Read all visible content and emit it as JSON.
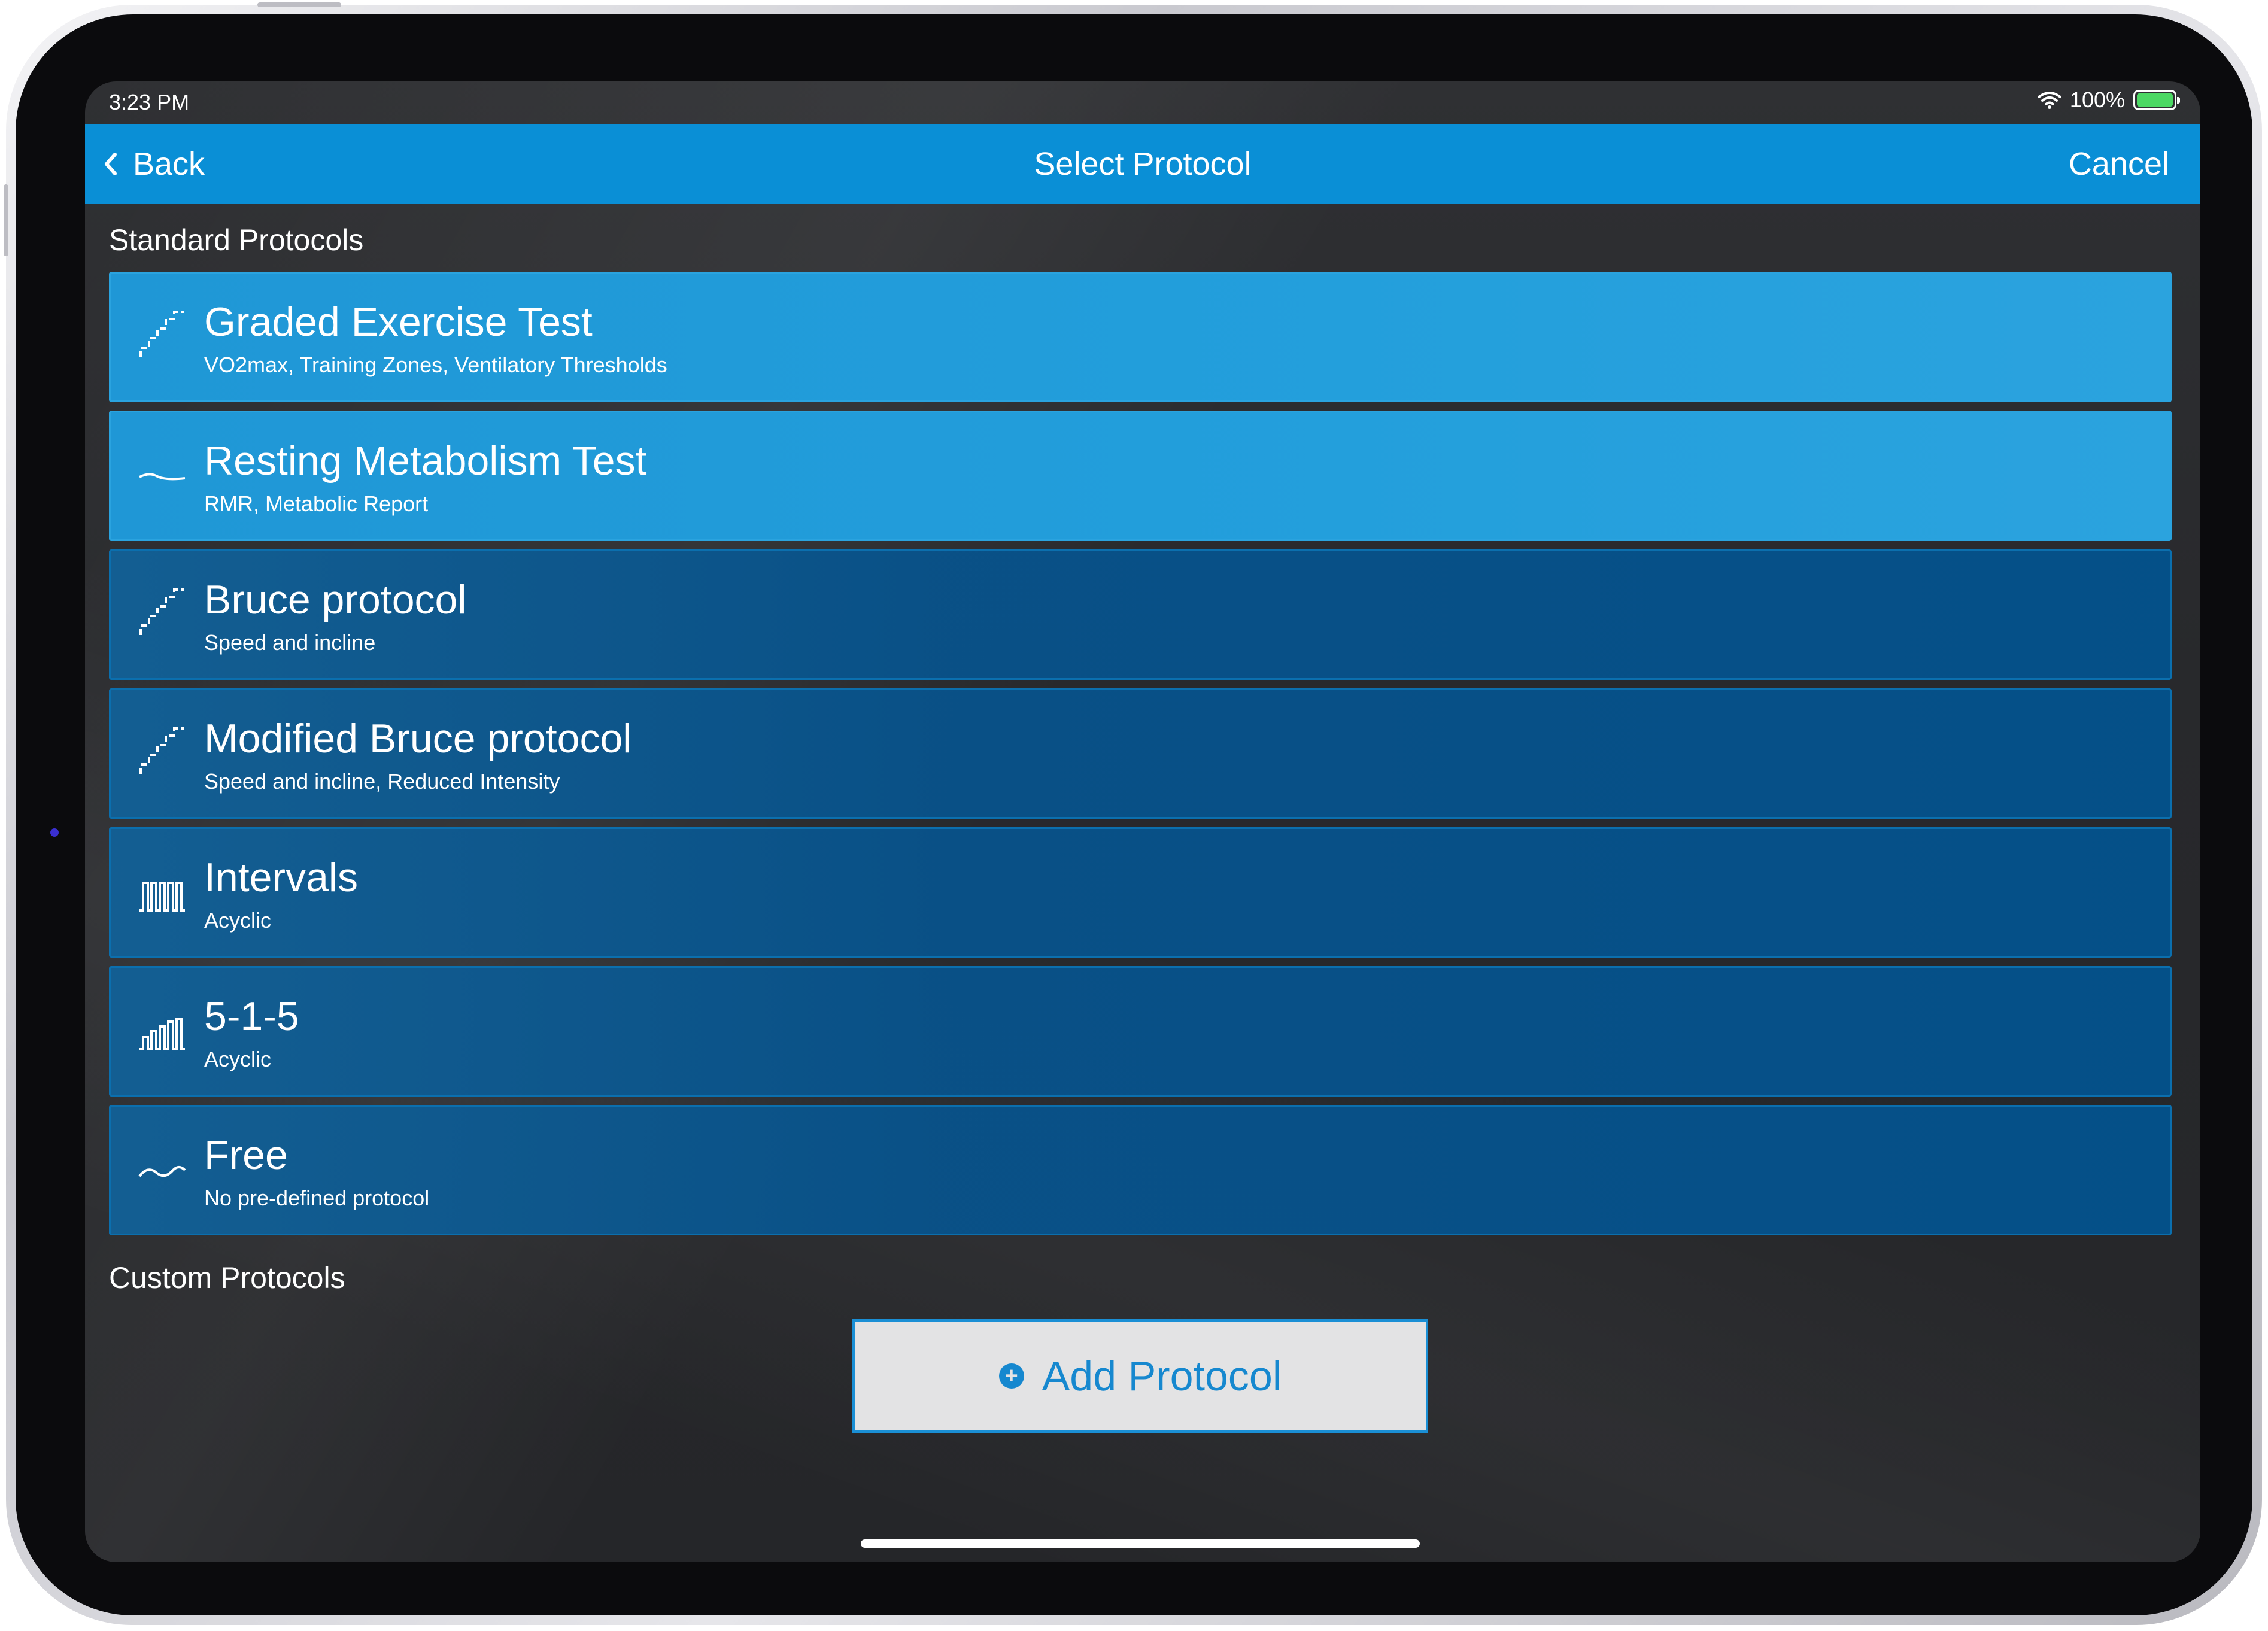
{
  "status_bar": {
    "time": "3:23 PM",
    "battery": "100%",
    "battery_level": 1.0
  },
  "nav": {
    "back_label": "Back",
    "title": "Select Protocol",
    "cancel_label": "Cancel"
  },
  "standard_section": {
    "title": "Standard Protocols"
  },
  "protocols": [
    {
      "title": "Graded Exercise Test",
      "subtitle": "VO2max, Training Zones, Ventilatory Thresholds",
      "icon": "stairs-icon",
      "selected": true
    },
    {
      "title": "Resting Metabolism Test",
      "subtitle": "RMR, Metabolic Report",
      "icon": "flat-curve-icon",
      "selected": true
    },
    {
      "title": "Bruce protocol",
      "subtitle": "Speed and incline",
      "icon": "stairs-icon",
      "selected": false
    },
    {
      "title": "Modified Bruce protocol",
      "subtitle": "Speed and incline, Reduced Intensity",
      "icon": "stairs-icon",
      "selected": false
    },
    {
      "title": "Intervals",
      "subtitle": "Acyclic",
      "icon": "intervals-icon",
      "selected": false
    },
    {
      "title": "5-1-5",
      "subtitle": "Acyclic",
      "icon": "interval-bars-icon",
      "selected": false
    },
    {
      "title": "Free",
      "subtitle": "No pre-defined protocol",
      "icon": "wave-icon",
      "selected": false
    }
  ],
  "custom_section": {
    "title": "Custom Protocols",
    "add_label": "Add Protocol"
  },
  "colors": {
    "accent": "#0a8fd6",
    "selected_row": "#239fdc",
    "row": "#08528a",
    "add_button_bg": "#e3e3e4"
  }
}
